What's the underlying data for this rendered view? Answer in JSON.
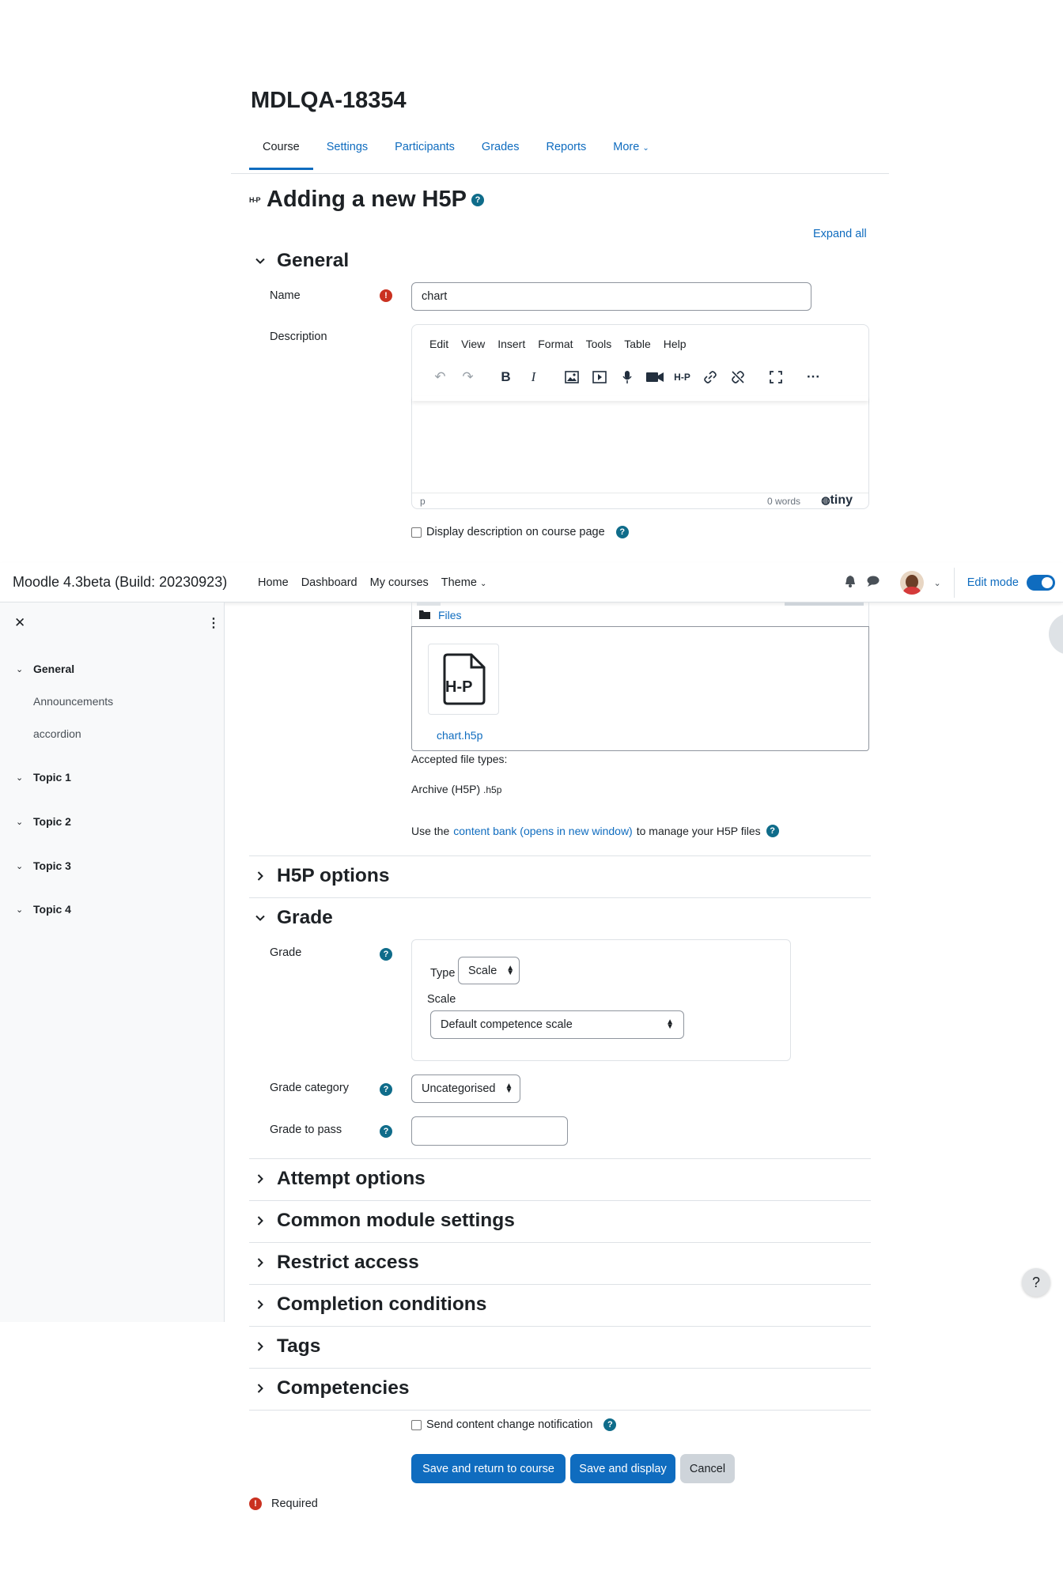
{
  "course": {
    "title": "MDLQA-18354",
    "tabs": [
      "Course",
      "Settings",
      "Participants",
      "Grades",
      "Reports",
      "More"
    ]
  },
  "heading": {
    "icon_text": "H-P",
    "title": "Adding a new H5P",
    "help": "?"
  },
  "expand_all": "Expand all",
  "general": {
    "title": "General",
    "name_label": "Name",
    "name_value": "chart",
    "description_label": "Description",
    "editor": {
      "menus": [
        "Edit",
        "View",
        "Insert",
        "Format",
        "Tools",
        "Table",
        "Help"
      ],
      "status_path": "p",
      "word_count": "0 words",
      "brand": "tiny",
      "h5p_button": "H-P"
    },
    "display_description": "Display description on course page"
  },
  "navbar": {
    "brand": "Moodle 4.3beta (Build: 20230923)",
    "links": [
      "Home",
      "Dashboard",
      "My courses",
      "Theme"
    ],
    "edit_mode": "Edit mode"
  },
  "drawer": {
    "sections": [
      {
        "label": "General",
        "children": [
          "Announcements",
          "accordion"
        ]
      },
      {
        "label": "Topic 1"
      },
      {
        "label": "Topic 2"
      },
      {
        "label": "Topic 3"
      },
      {
        "label": "Topic 4"
      }
    ]
  },
  "files": {
    "folder": "Files",
    "thumb_text": "H-P",
    "file_name": "chart.h5p",
    "accepted_label": "Accepted file types:",
    "accepted_types": "Archive (H5P)",
    "accepted_ext": ".h5p",
    "cb_pre": "Use the",
    "cb_link": "content bank (opens in new window)",
    "cb_post": "to manage your H5P files"
  },
  "h5p_options": {
    "title": "H5P options"
  },
  "grade": {
    "title": "Grade",
    "grade_label": "Grade",
    "type_label": "Type",
    "type_value": "Scale",
    "scale_label": "Scale",
    "scale_value": "Default competence scale",
    "category_label": "Grade category",
    "category_value": "Uncategorised",
    "pass_label": "Grade to pass",
    "pass_value": ""
  },
  "collapsed_sections": [
    "Attempt options",
    "Common module settings",
    "Restrict access",
    "Completion conditions",
    "Tags",
    "Competencies"
  ],
  "send_notification": "Send content change notification",
  "buttons": {
    "save_return": "Save and return to course",
    "save_display": "Save and display",
    "cancel": "Cancel"
  },
  "required": "Required",
  "help_fab": "?",
  "colors": {
    "primary": "#0f6cbf",
    "required": "#ca3120",
    "help": "#0f6c8a"
  }
}
